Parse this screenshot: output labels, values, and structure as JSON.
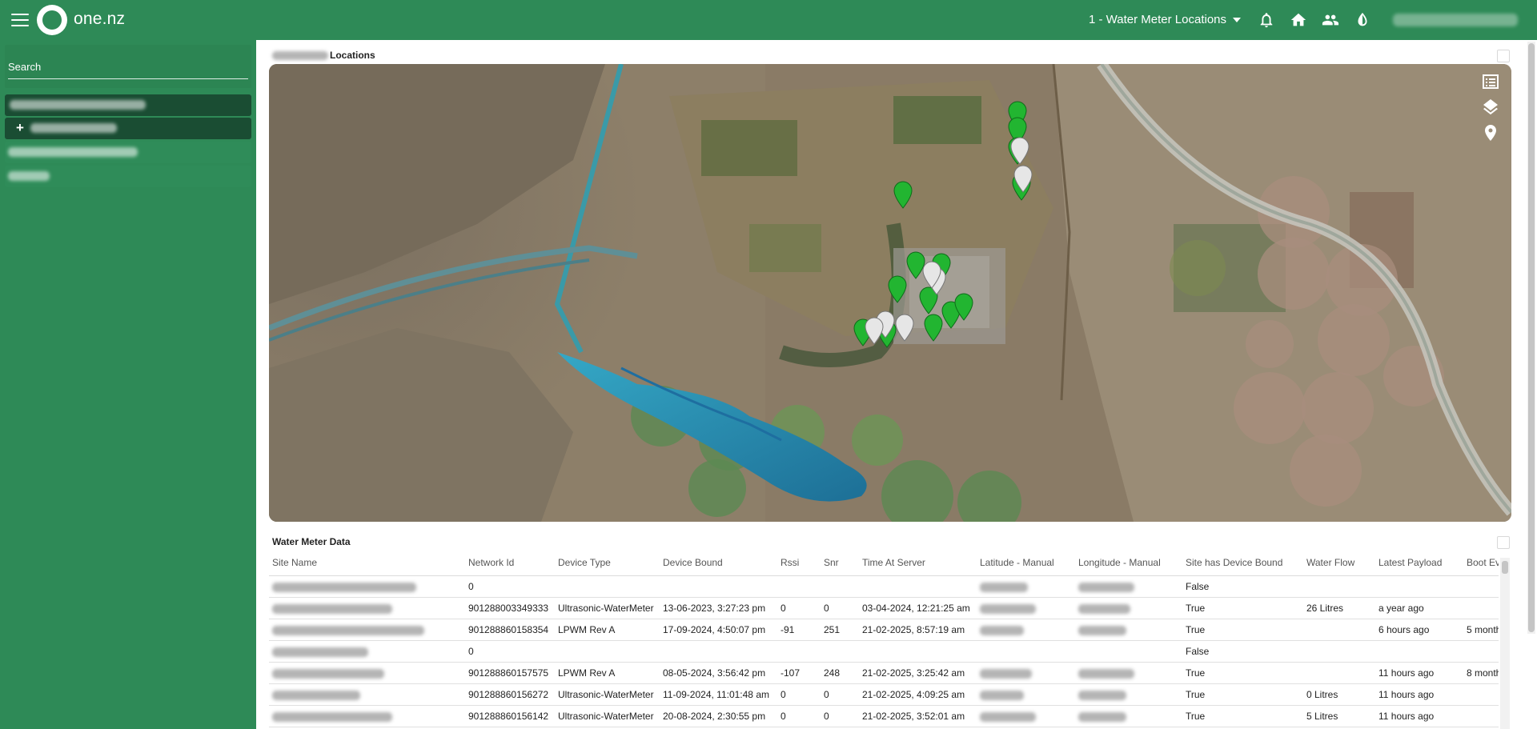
{
  "header": {
    "logo_text": "one.nz",
    "dashboard_selector": "1 - Water Meter Locations",
    "icons": [
      "menu-icon",
      "bell-icon",
      "home-icon",
      "users-icon",
      "contrast-icon"
    ]
  },
  "sidebar": {
    "search_label": "Search"
  },
  "map_panel": {
    "title": "Locations",
    "controls": [
      "list-icon",
      "layers-icon",
      "marker-icon"
    ]
  },
  "table_panel": {
    "title": "Water Meter Data",
    "columns": [
      "Site Name",
      "Network Id",
      "Device Type",
      "Device Bound",
      "Rssi",
      "Snr",
      "Time At Server",
      "Latitude - Manual",
      "Longitude - Manual",
      "Site has Device Bound",
      "Water Flow",
      "Latest Payload",
      "Boot Ev"
    ],
    "rows": [
      {
        "network_id": "0",
        "device_type": "",
        "device_bound": "",
        "rssi": "",
        "snr": "",
        "time_at_server": "",
        "site_has_device": "False",
        "water_flow": "",
        "latest_payload": "",
        "boot": ""
      },
      {
        "network_id": "901288003349333",
        "device_type": "Ultrasonic-WaterMeter",
        "device_bound": "13-06-2023, 3:27:23 pm",
        "rssi": "0",
        "snr": "0",
        "time_at_server": "03-04-2024, 12:21:25 am",
        "site_has_device": "True",
        "water_flow": "26 Litres",
        "latest_payload": "a year ago",
        "boot": ""
      },
      {
        "network_id": "901288860158354",
        "device_type": "LPWM Rev A",
        "device_bound": "17-09-2024, 4:50:07 pm",
        "rssi": "-91",
        "snr": "251",
        "time_at_server": "21-02-2025, 8:57:19 am",
        "site_has_device": "True",
        "water_flow": "",
        "latest_payload": "6 hours ago",
        "boot": "5 month"
      },
      {
        "network_id": "0",
        "device_type": "",
        "device_bound": "",
        "rssi": "",
        "snr": "",
        "time_at_server": "",
        "site_has_device": "False",
        "water_flow": "",
        "latest_payload": "",
        "boot": ""
      },
      {
        "network_id": "901288860157575",
        "device_type": "LPWM Rev A",
        "device_bound": "08-05-2024, 3:56:42 pm",
        "rssi": "-107",
        "snr": "248",
        "time_at_server": "21-02-2025, 3:25:42 am",
        "site_has_device": "True",
        "water_flow": "",
        "latest_payload": "11 hours ago",
        "boot": "8 month"
      },
      {
        "network_id": "901288860156272",
        "device_type": "Ultrasonic-WaterMeter",
        "device_bound": "11-09-2024, 11:01:48 am",
        "rssi": "0",
        "snr": "0",
        "time_at_server": "21-02-2025, 4:09:25 am",
        "site_has_device": "True",
        "water_flow": "0 Litres",
        "latest_payload": "11 hours ago",
        "boot": ""
      },
      {
        "network_id": "901288860156142",
        "device_type": "Ultrasonic-WaterMeter",
        "device_bound": "20-08-2024, 2:30:55 pm",
        "rssi": "0",
        "snr": "0",
        "time_at_server": "21-02-2025, 3:52:01 am",
        "site_has_device": "True",
        "water_flow": "5 Litres",
        "latest_payload": "11 hours ago",
        "boot": ""
      }
    ]
  },
  "colors": {
    "brand_green": "#2e8a57",
    "sidebar_selected": "#1a4d33",
    "marker_green": "#22b531",
    "marker_white": "#e6e6e6"
  }
}
